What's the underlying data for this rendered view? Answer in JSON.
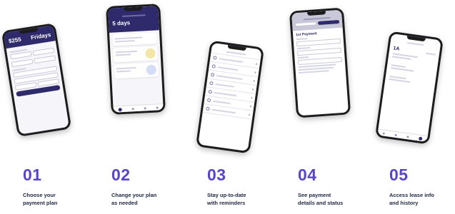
{
  "steps": [
    {
      "number": "01",
      "caption_line1": "Choose your",
      "caption_line2": "payment plan"
    },
    {
      "number": "02",
      "caption_line1": "Change your plan",
      "caption_line2": "as needed"
    },
    {
      "number": "03",
      "caption_line1": "Stay up-to-date",
      "caption_line2": "with reminders"
    },
    {
      "number": "04",
      "caption_line1": "See payment",
      "caption_line2": "details and status"
    },
    {
      "number": "05",
      "caption_line1": "Access lease info",
      "caption_line2": "and history"
    }
  ],
  "phone1": {
    "amount": "$255",
    "frequency": "Fridays"
  },
  "phone2": {
    "countdown": "5 days"
  },
  "phone4": {
    "title": "1st Payment"
  },
  "phone5": {
    "value": "1A"
  },
  "colors": {
    "brand_navy": "#2f2a6b",
    "accent_purple": "#5a44c9"
  }
}
